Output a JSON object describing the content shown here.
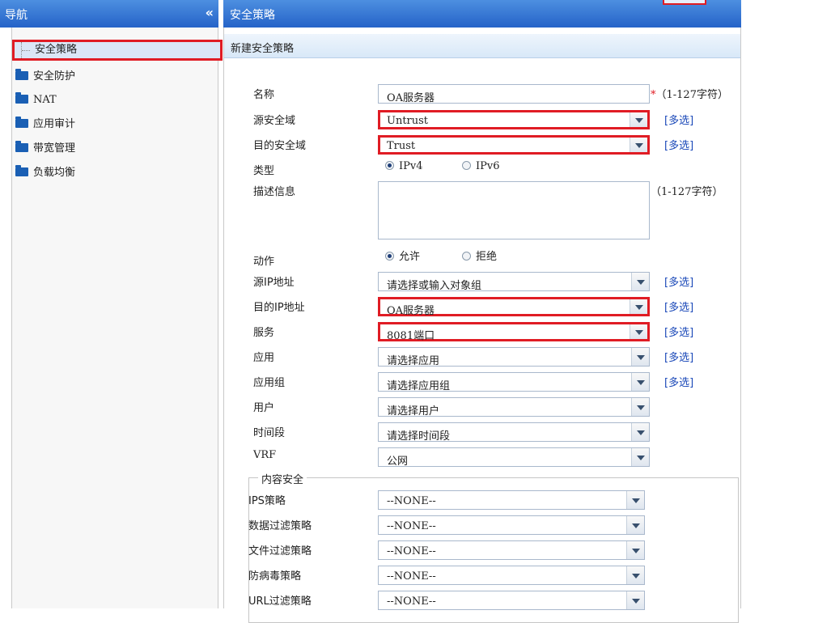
{
  "nav": {
    "title": "导航",
    "collapse_icon": "«"
  },
  "sidebar": {
    "items": [
      {
        "label": "安全策略",
        "selected": true
      },
      {
        "label": "安全防护"
      },
      {
        "label": "NAT"
      },
      {
        "label": "应用审计"
      },
      {
        "label": "带宽管理"
      },
      {
        "label": "负载均衡"
      }
    ]
  },
  "main": {
    "title": "安全策略",
    "subtitle": "新建安全策略",
    "form": {
      "name": {
        "label": "名称",
        "value": "OA服务器",
        "required": "*",
        "hint": "（1-127字符）"
      },
      "src_zone": {
        "label": "源安全域",
        "value": "Untrust",
        "multi": "[多选]"
      },
      "dst_zone": {
        "label": "目的安全域",
        "value": "Trust",
        "multi": "[多选]"
      },
      "type": {
        "label": "类型",
        "options": [
          "IPv4",
          "IPv6"
        ],
        "selected": "IPv4"
      },
      "desc": {
        "label": "描述信息",
        "hint": "（1-127字符）"
      },
      "action": {
        "label": "动作",
        "options": [
          "允许",
          "拒绝"
        ],
        "selected": "允许"
      },
      "src_ip": {
        "label": "源IP地址",
        "value": "请选择或输入对象组",
        "multi": "[多选]"
      },
      "dst_ip": {
        "label": "目的IP地址",
        "value": "OA服务器",
        "multi": "[多选]"
      },
      "service": {
        "label": "服务",
        "value": "8081端口",
        "multi": "[多选]"
      },
      "app": {
        "label": "应用",
        "value": "请选择应用",
        "multi": "[多选]"
      },
      "app_group": {
        "label": "应用组",
        "value": "请选择应用组",
        "multi": "[多选]"
      },
      "user": {
        "label": "用户",
        "value": "请选择用户"
      },
      "time": {
        "label": "时间段",
        "value": "请选择时间段"
      },
      "vrf": {
        "label": "VRF",
        "value": "公网"
      }
    },
    "content_security": {
      "legend": "内容安全",
      "ips": {
        "label": "IPS策略",
        "value": "--NONE--"
      },
      "data_filter": {
        "label": "数据过滤策略",
        "value": "--NONE--"
      },
      "file_filter": {
        "label": "文件过滤策略",
        "value": "--NONE--"
      },
      "antivirus": {
        "label": "防病毒策略",
        "value": "--NONE--"
      },
      "url_filter": {
        "label": "URL过滤策略",
        "value": "--NONE--"
      }
    }
  },
  "colors": {
    "header_blue": "#2563c8",
    "highlight_red": "#e01c24",
    "link_blue": "#1a48b8"
  }
}
